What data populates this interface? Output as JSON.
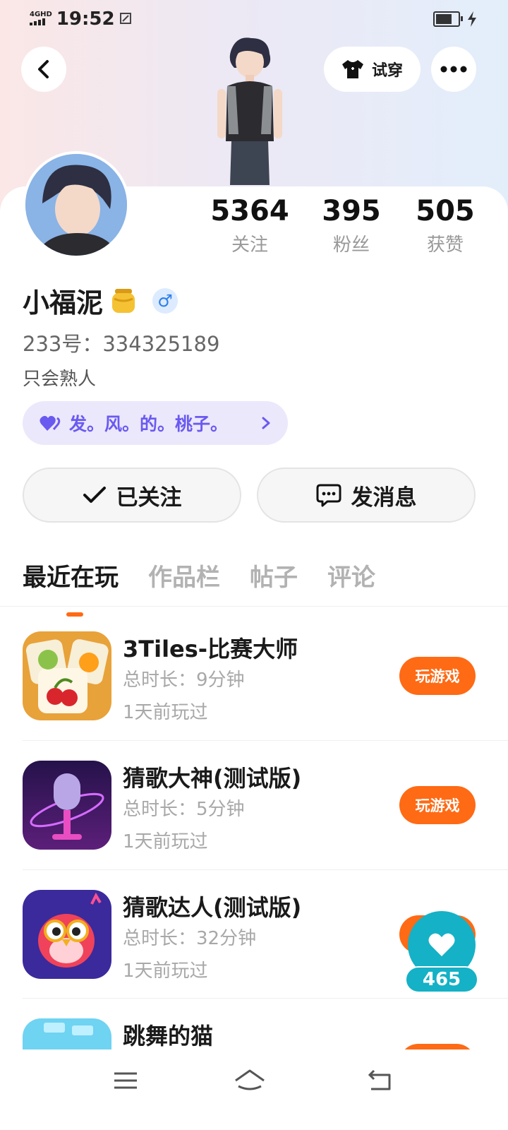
{
  "status_bar": {
    "network": "4GHD",
    "time": "19:52"
  },
  "header": {
    "try_on_label": "试穿"
  },
  "profile": {
    "stats": [
      {
        "value": "5364",
        "label": "关注"
      },
      {
        "value": "395",
        "label": "粉丝"
      },
      {
        "value": "505",
        "label": "获赞"
      }
    ],
    "name": "小福泥",
    "gender_symbol": "♂",
    "uid": "233号：334325189",
    "bio": "只会熟人",
    "tag": "发。风。的。桃子。"
  },
  "actions": {
    "followed_label": "已关注",
    "message_label": "发消息"
  },
  "tabs": [
    "最近在玩",
    "作品栏",
    "帖子",
    "评论"
  ],
  "games": [
    {
      "title": "3Tiles-比赛大师",
      "duration": "总时长：9分钟",
      "last_played": "1天前玩过",
      "button": "玩游戏"
    },
    {
      "title": "猜歌大神(测试版)",
      "duration": "总时长：5分钟",
      "last_played": "1天前玩过",
      "button": "玩游戏"
    },
    {
      "title": "猜歌达人(测试版)",
      "duration": "总时长：32分钟",
      "last_played": "1天前玩过",
      "button": "玩游戏"
    },
    {
      "title": "跳舞的猫",
      "duration": "",
      "last_played": "",
      "button": ""
    }
  ],
  "like_fab": {
    "count": "465"
  },
  "colors": {
    "accent": "#ff6a14",
    "like": "#15b1c6",
    "tag_bg": "#ebe8fc",
    "tag_text": "#6a5af0"
  }
}
